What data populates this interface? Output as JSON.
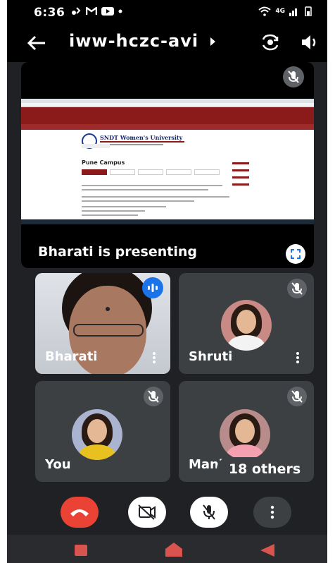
{
  "status_bar": {
    "time": "6:36",
    "network": "4G"
  },
  "meeting": {
    "code": "iww-hczc-avi"
  },
  "presentation": {
    "shared_site_title": "SNDT Women's University",
    "shared_page_heading": "Pune Campus",
    "presenting_label": "Bharati is presenting"
  },
  "participants": [
    {
      "name": "Bharati",
      "speaking": true
    },
    {
      "name": "Shruti",
      "muted": true
    },
    {
      "name": "You",
      "muted": true
    },
    {
      "name": "Manisha",
      "muted": true
    }
  ],
  "others_count_label": "18 others",
  "colors": {
    "background": "#202124",
    "tile": "#3c4043",
    "end_call": "#ea4335",
    "speaking": "#1a73e8",
    "site_brand": "#8b1a1a"
  },
  "icons": {
    "back": "arrow-left-icon",
    "switch_camera": "switch-camera-icon",
    "speaker": "volume-icon",
    "fullscreen": "fullscreen-icon",
    "mic_off": "mic-off-icon",
    "camera_off": "camera-off-icon",
    "end_call": "end-call-icon",
    "more": "more-vertical-icon"
  }
}
